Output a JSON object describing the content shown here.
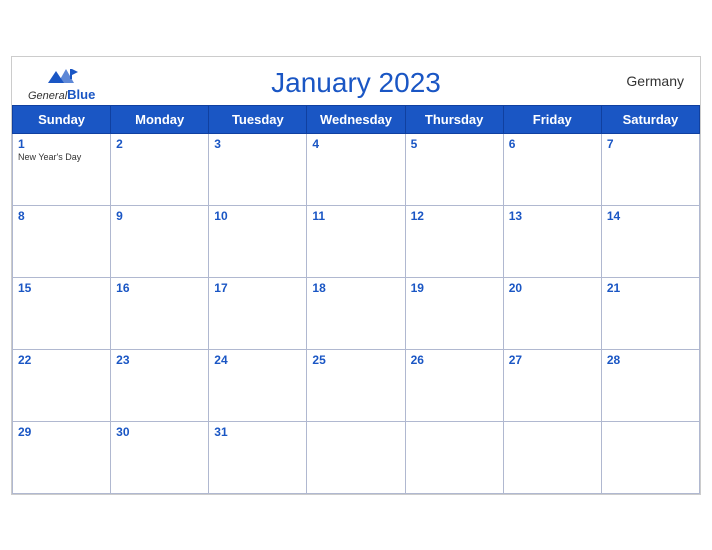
{
  "header": {
    "title": "January 2023",
    "country": "Germany",
    "logo": {
      "general": "General",
      "blue": "Blue"
    }
  },
  "days_of_week": [
    "Sunday",
    "Monday",
    "Tuesday",
    "Wednesday",
    "Thursday",
    "Friday",
    "Saturday"
  ],
  "weeks": [
    [
      {
        "day": "1",
        "holiday": "New Year's Day"
      },
      {
        "day": "2",
        "holiday": ""
      },
      {
        "day": "3",
        "holiday": ""
      },
      {
        "day": "4",
        "holiday": ""
      },
      {
        "day": "5",
        "holiday": ""
      },
      {
        "day": "6",
        "holiday": ""
      },
      {
        "day": "7",
        "holiday": ""
      }
    ],
    [
      {
        "day": "8",
        "holiday": ""
      },
      {
        "day": "9",
        "holiday": ""
      },
      {
        "day": "10",
        "holiday": ""
      },
      {
        "day": "11",
        "holiday": ""
      },
      {
        "day": "12",
        "holiday": ""
      },
      {
        "day": "13",
        "holiday": ""
      },
      {
        "day": "14",
        "holiday": ""
      }
    ],
    [
      {
        "day": "15",
        "holiday": ""
      },
      {
        "day": "16",
        "holiday": ""
      },
      {
        "day": "17",
        "holiday": ""
      },
      {
        "day": "18",
        "holiday": ""
      },
      {
        "day": "19",
        "holiday": ""
      },
      {
        "day": "20",
        "holiday": ""
      },
      {
        "day": "21",
        "holiday": ""
      }
    ],
    [
      {
        "day": "22",
        "holiday": ""
      },
      {
        "day": "23",
        "holiday": ""
      },
      {
        "day": "24",
        "holiday": ""
      },
      {
        "day": "25",
        "holiday": ""
      },
      {
        "day": "26",
        "holiday": ""
      },
      {
        "day": "27",
        "holiday": ""
      },
      {
        "day": "28",
        "holiday": ""
      }
    ],
    [
      {
        "day": "29",
        "holiday": ""
      },
      {
        "day": "30",
        "holiday": ""
      },
      {
        "day": "31",
        "holiday": ""
      },
      {
        "day": "",
        "holiday": ""
      },
      {
        "day": "",
        "holiday": ""
      },
      {
        "day": "",
        "holiday": ""
      },
      {
        "day": "",
        "holiday": ""
      }
    ]
  ],
  "colors": {
    "header_bg": "#1a56c4",
    "title_color": "#1a56c4",
    "day_number_color": "#1a56c4"
  }
}
